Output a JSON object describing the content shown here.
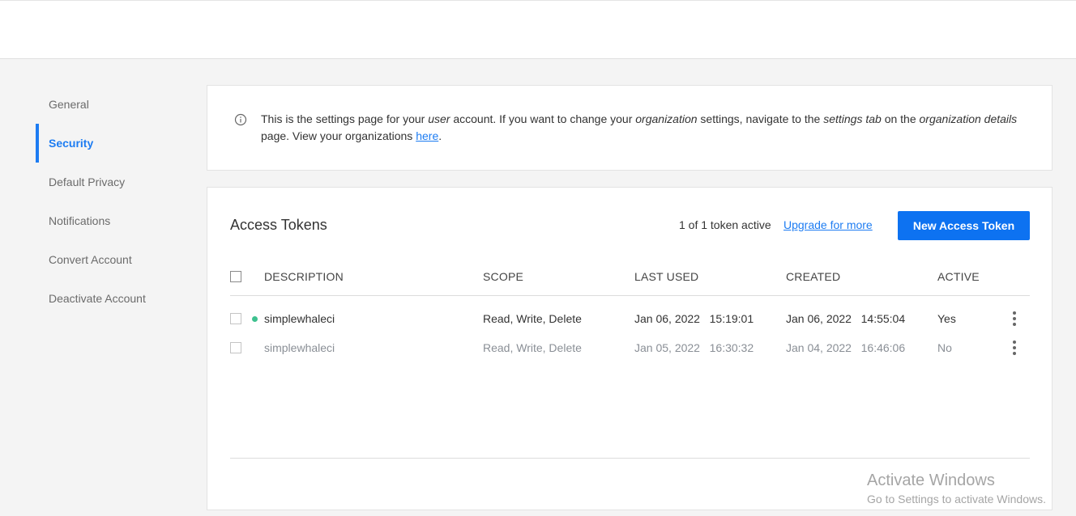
{
  "sidebar": {
    "items": [
      {
        "label": "General"
      },
      {
        "label": "Security"
      },
      {
        "label": "Default Privacy"
      },
      {
        "label": "Notifications"
      },
      {
        "label": "Convert Account"
      },
      {
        "label": "Deactivate Account"
      }
    ],
    "active": "Security"
  },
  "info": {
    "text_1": "This is the settings page for your ",
    "em_1": "user",
    "text_2": " account. If you want to change your ",
    "em_2": "organization",
    "text_3": " settings, navigate to the ",
    "em_3": "settings tab",
    "text_4": " on the ",
    "em_4": "organization details",
    "text_5": " page. View your organizations ",
    "link": "here",
    "text_6": "."
  },
  "tokens": {
    "title": "Access Tokens",
    "count_text": "1 of 1 token active",
    "upgrade_label": "Upgrade for more",
    "new_button_label": "New Access Token",
    "columns": {
      "description": "DESCRIPTION",
      "scope": "SCOPE",
      "last_used": "LAST USED",
      "created": "CREATED",
      "active": "ACTIVE"
    },
    "rows": [
      {
        "description": "simplewhaleci",
        "scope": "Read, Write, Delete",
        "last_used": "Jan 06, 2022   15:19:01",
        "created": "Jan 06, 2022   14:55:04",
        "active": "Yes"
      },
      {
        "description": "simplewhaleci",
        "scope": "Read, Write, Delete",
        "last_used": "Jan 05, 2022   16:30:32",
        "created": "Jan 04, 2022   16:46:06",
        "active": "No"
      }
    ]
  },
  "colors": {
    "accent": "#1d7cf2",
    "button": "#0d72f1",
    "active_dot": "#3ec18f"
  },
  "icons": {
    "info": "info-circle-icon",
    "row_menu": "kebab-menu-icon"
  },
  "watermark": {
    "title": "Activate Windows",
    "subtitle": "Go to Settings to activate Windows."
  }
}
